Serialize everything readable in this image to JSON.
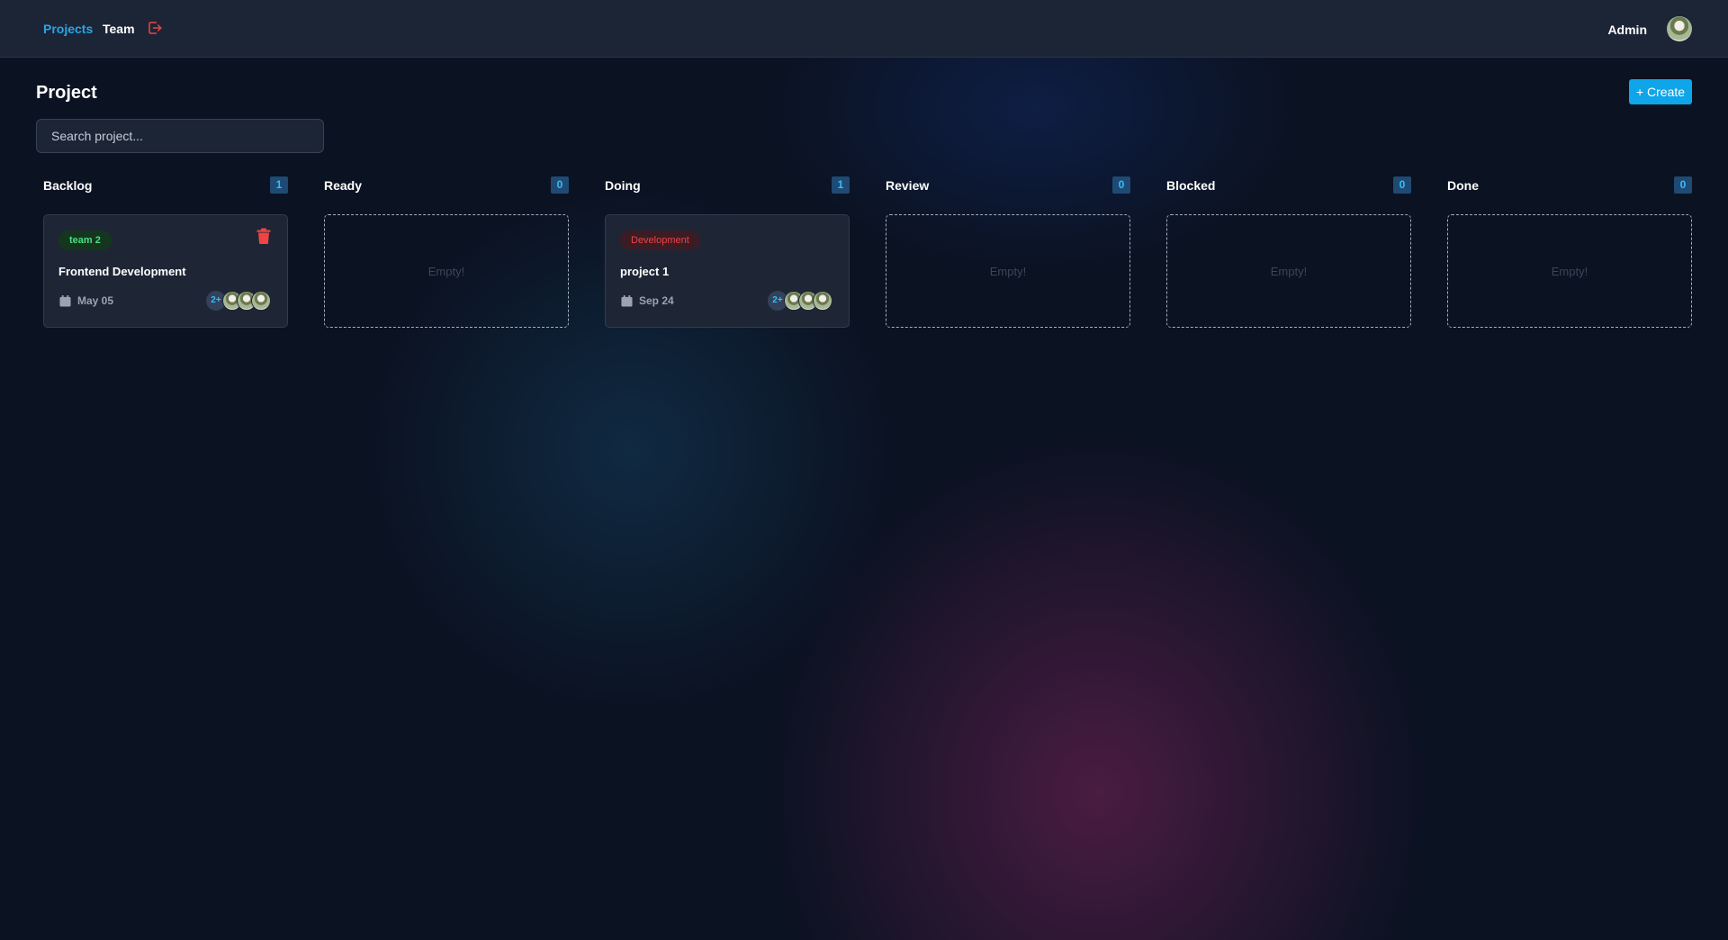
{
  "nav": {
    "projects": "Projects",
    "team": "Team",
    "logout_icon": "logout-icon",
    "user_name": "Admin"
  },
  "page": {
    "title": "Project",
    "create_label": "+ Create",
    "search_placeholder": "Search project..."
  },
  "columns": [
    {
      "title": "Backlog",
      "count": "1",
      "card": {
        "tag": "team 2",
        "tag_color": "#4ade80",
        "title": "Frontend Development",
        "date": "May 05",
        "members_more": "2+"
      }
    },
    {
      "title": "Ready",
      "count": "0",
      "empty_text": "Empty!"
    },
    {
      "title": "Doing",
      "count": "1",
      "card": {
        "tag": "Development",
        "tag_color": "#ef4444",
        "title": "project 1",
        "date": "Sep 24",
        "members_more": "2+"
      }
    },
    {
      "title": "Review",
      "count": "0",
      "empty_text": "Empty!"
    },
    {
      "title": "Blocked",
      "count": "0",
      "empty_text": "Empty!"
    },
    {
      "title": "Done",
      "count": "0",
      "empty_text": "Empty!"
    }
  ],
  "colors": {
    "accent": "#0ea5e9",
    "nav_active": "#2aa4e8",
    "danger": "#ef4444",
    "background": "#0b1222"
  }
}
